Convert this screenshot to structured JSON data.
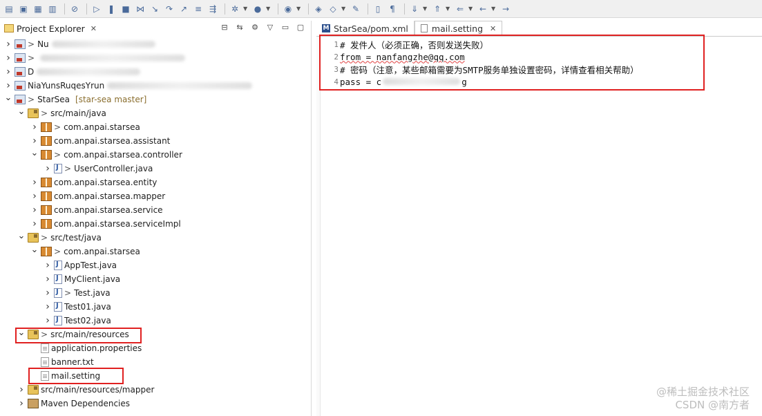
{
  "toolbar": {
    "icons": [
      "new-icon",
      "save-icon",
      "save-all-icon",
      "print-icon",
      "debug-skip-icon",
      "resume-icon",
      "suspend-icon",
      "terminate-icon",
      "disconnect-icon",
      "step-into-icon",
      "step-over-icon",
      "step-return-icon",
      "drop-to-frame-icon",
      "use-step-filters-icon",
      "debug-icon",
      "run-icon",
      "run-external-icon",
      "new-java-project-icon",
      "open-type-icon",
      "open-task-icon",
      "toggle-mark-icon",
      "show-whitespace-icon",
      "next-annotation-icon",
      "prev-annotation-icon",
      "last-edit-icon",
      "back-icon",
      "forward-icon"
    ]
  },
  "explorer": {
    "tab_label": "Project Explorer",
    "tree": [
      {
        "depth": 0,
        "twisty": ">",
        "icon": "proj",
        "prefix": ">",
        "label": "Nu",
        "redacted": true
      },
      {
        "depth": 0,
        "twisty": ">",
        "icon": "proj",
        "prefix": ">",
        "label": "",
        "redacted": true
      },
      {
        "depth": 0,
        "twisty": ">",
        "icon": "proj",
        "prefix": "",
        "label": "D",
        "redacted": true
      },
      {
        "depth": 0,
        "twisty": ">",
        "icon": "proj",
        "prefix": "",
        "label": "NiaYunsRuqesYrun",
        "redacted": true
      },
      {
        "depth": 0,
        "twisty": "v",
        "icon": "proj",
        "prefix": ">",
        "label": "StarSea",
        "tag": "[star-sea master]"
      },
      {
        "depth": 1,
        "twisty": "v",
        "icon": "folder",
        "prefix": ">",
        "label": "src/main/java"
      },
      {
        "depth": 2,
        "twisty": ">",
        "icon": "pkg",
        "prefix": ">",
        "label": "com.anpai.starsea"
      },
      {
        "depth": 2,
        "twisty": ">",
        "icon": "pkg",
        "prefix": "",
        "label": "com.anpai.starsea.assistant"
      },
      {
        "depth": 2,
        "twisty": "v",
        "icon": "pkg",
        "prefix": ">",
        "label": "com.anpai.starsea.controller"
      },
      {
        "depth": 3,
        "twisty": ">",
        "icon": "java",
        "prefix": ">",
        "label": "UserController.java"
      },
      {
        "depth": 2,
        "twisty": ">",
        "icon": "pkg",
        "prefix": "",
        "label": "com.anpai.starsea.entity"
      },
      {
        "depth": 2,
        "twisty": ">",
        "icon": "pkg",
        "prefix": "",
        "label": "com.anpai.starsea.mapper"
      },
      {
        "depth": 2,
        "twisty": ">",
        "icon": "pkg",
        "prefix": "",
        "label": "com.anpai.starsea.service"
      },
      {
        "depth": 2,
        "twisty": ">",
        "icon": "pkg",
        "prefix": "",
        "label": "com.anpai.starsea.serviceImpl"
      },
      {
        "depth": 1,
        "twisty": "v",
        "icon": "folder",
        "prefix": ">",
        "label": "src/test/java"
      },
      {
        "depth": 2,
        "twisty": "v",
        "icon": "pkg",
        "prefix": ">",
        "label": "com.anpai.starsea"
      },
      {
        "depth": 3,
        "twisty": ">",
        "icon": "java",
        "prefix": "",
        "label": "AppTest.java"
      },
      {
        "depth": 3,
        "twisty": ">",
        "icon": "java",
        "prefix": "",
        "label": "MyClient.java"
      },
      {
        "depth": 3,
        "twisty": ">",
        "icon": "java",
        "prefix": ">",
        "label": "Test.java"
      },
      {
        "depth": 3,
        "twisty": ">",
        "icon": "java",
        "prefix": "",
        "label": "Test01.java"
      },
      {
        "depth": 3,
        "twisty": ">",
        "icon": "java",
        "prefix": "",
        "label": "Test02.java"
      },
      {
        "depth": 1,
        "twisty": "v",
        "icon": "folder",
        "prefix": ">",
        "label": "src/main/resources"
      },
      {
        "depth": 2,
        "twisty": "",
        "icon": "file",
        "prefix": "",
        "label": "application.properties"
      },
      {
        "depth": 2,
        "twisty": "",
        "icon": "file",
        "prefix": "",
        "label": "banner.txt"
      },
      {
        "depth": 2,
        "twisty": "",
        "icon": "file",
        "prefix": "",
        "label": "mail.setting"
      },
      {
        "depth": 1,
        "twisty": ">",
        "icon": "folder",
        "prefix": "",
        "label": "src/main/resources/mapper"
      },
      {
        "depth": 1,
        "twisty": ">",
        "icon": "lib",
        "prefix": "",
        "label": "Maven Dependencies"
      }
    ]
  },
  "editor": {
    "tabs": [
      {
        "label": "StarSea/pom.xml",
        "active": false
      },
      {
        "label": "mail.setting",
        "active": true
      }
    ],
    "lines": [
      {
        "num": "1",
        "text": "# 发件人（必须正确，否则发送失败）"
      },
      {
        "num": "2",
        "text": "from = nanfangzhe@qq.com"
      },
      {
        "num": "3",
        "text": "# 密码（注意，某些邮箱需要为SMTP服务单独设置密码，详情查看相关帮助）"
      },
      {
        "num": "4",
        "text": "pass = c",
        "tail": "g"
      }
    ]
  },
  "watermark": {
    "line1": "@稀土掘金技术社区",
    "line2": "CSDN @南方者"
  },
  "colors": {
    "highlight_box": "#e02020",
    "watermark": "#bdbdbd"
  }
}
